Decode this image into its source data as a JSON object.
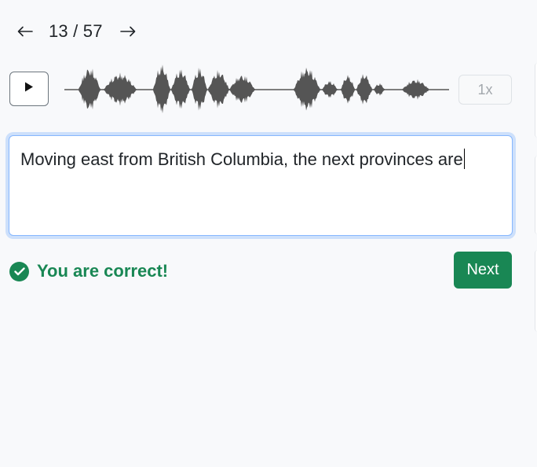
{
  "nav": {
    "prev_icon": "arrow-left-icon",
    "next_icon": "arrow-right-icon",
    "counter": "13 / 57"
  },
  "player": {
    "play_icon": "play-icon",
    "speed": "1x"
  },
  "answer": {
    "text": "Moving east from British Columbia, the next provinces are"
  },
  "feedback": {
    "icon": "check-circle-icon",
    "text": "You are correct!",
    "color": "#198754"
  },
  "actions": {
    "next_label": "Next",
    "accent": "#198754"
  },
  "waveform": {
    "color": "#555555"
  }
}
